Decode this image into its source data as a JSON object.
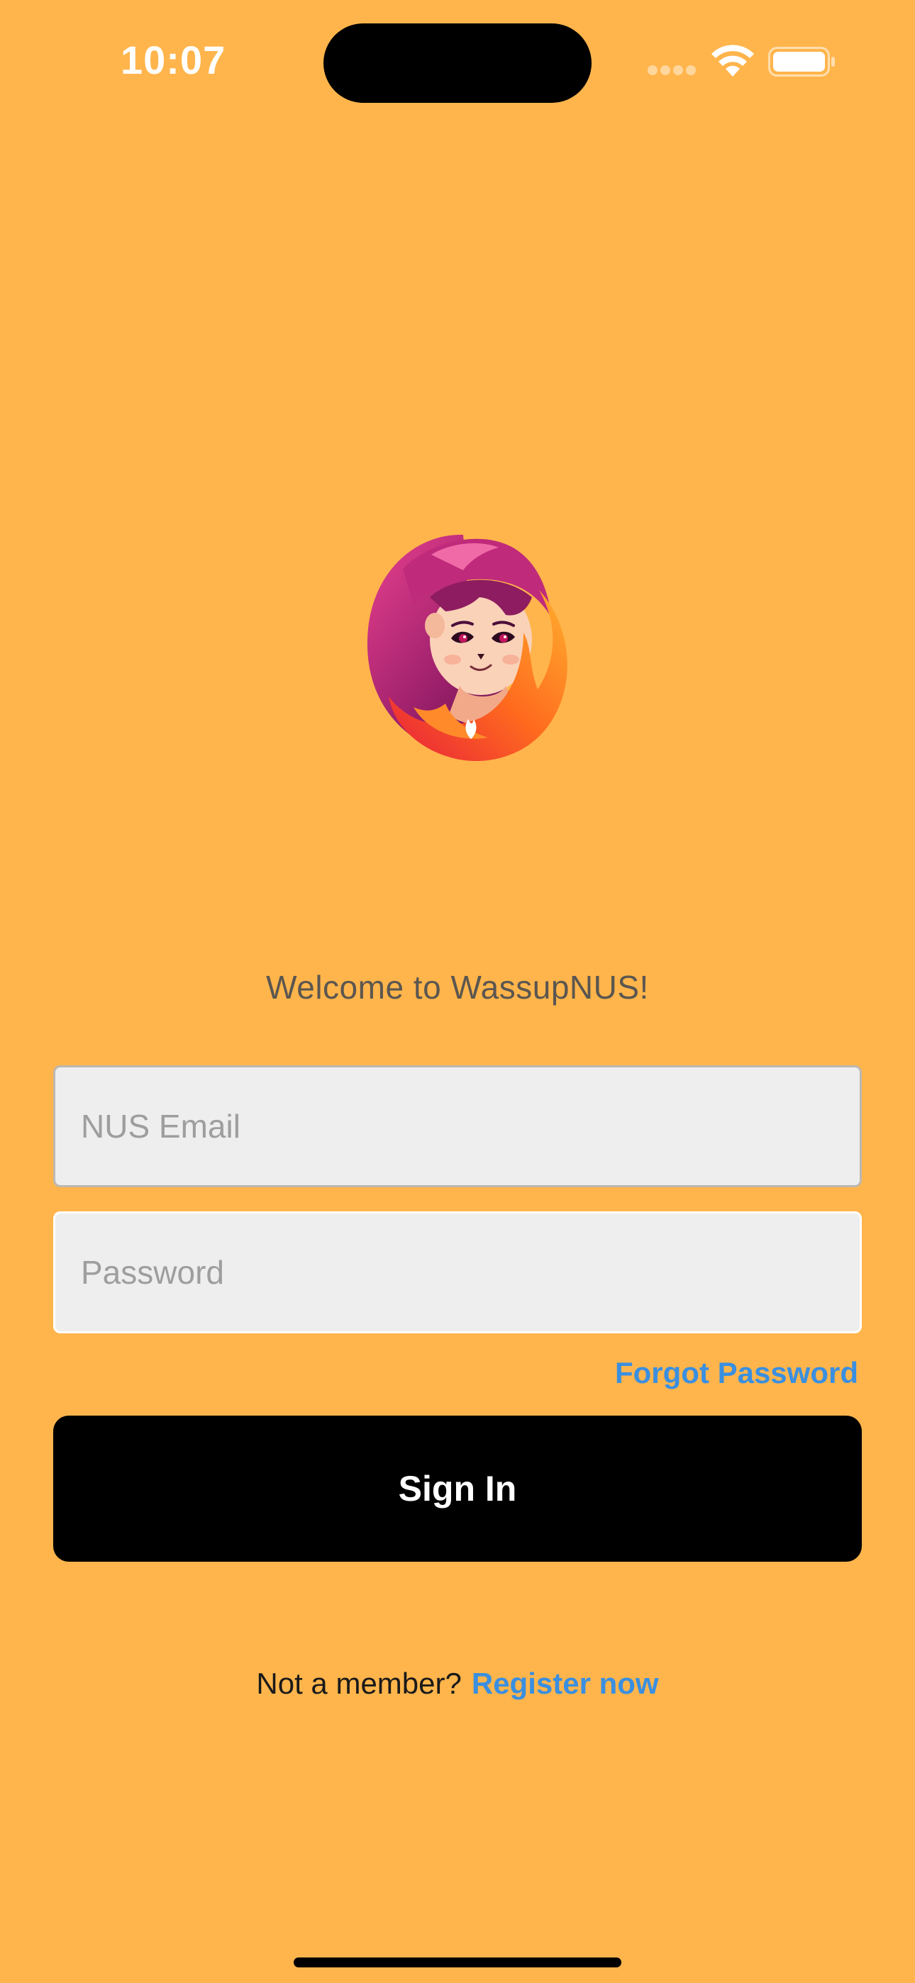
{
  "status_bar": {
    "time": "10:07",
    "icons": [
      "cellular-signal-icon",
      "wifi-icon",
      "battery-icon"
    ]
  },
  "logo": {
    "icon": "flame-girl-mascot-logo"
  },
  "welcome_text": "Welcome to WassupNUS!",
  "form": {
    "email": {
      "placeholder": "NUS Email",
      "value": ""
    },
    "password": {
      "placeholder": "Password",
      "value": ""
    },
    "forgot_password_label": "Forgot Password",
    "sign_in_label": "Sign In"
  },
  "footer": {
    "prompt": "Not a member?",
    "register_label": "Register now"
  },
  "colors": {
    "background": "#FFB54C",
    "accent_link": "#3A8FE0",
    "button": "#000000",
    "input_fill": "#EEEEEE"
  }
}
